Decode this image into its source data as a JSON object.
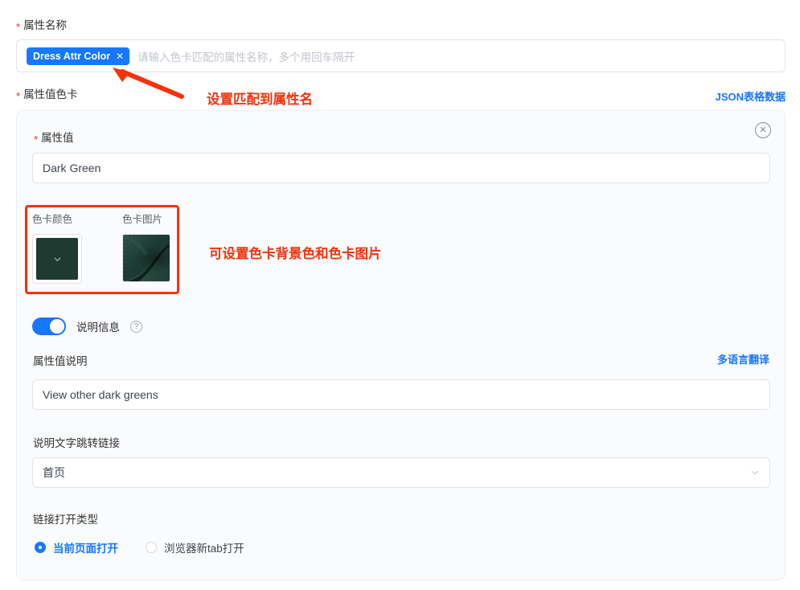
{
  "form": {
    "attr_name": {
      "label": "属性名称",
      "required_mark": "*",
      "tag": "Dress Attr Color",
      "tag_close": "✕",
      "placeholder": "请输入色卡匹配的属性名称，多个用回车隔开"
    },
    "attr_card": {
      "label": "属性值色卡",
      "required_mark": "*",
      "json_link": "JSON表格数据"
    },
    "card": {
      "close_icon": "✕",
      "attr_value": {
        "label": "属性值",
        "required_mark": "*",
        "value": "Dark Green"
      },
      "swatches": {
        "color_title": "色卡颜色",
        "image_title": "色卡图片",
        "color_hex": "#1f3a31",
        "image_base_hex": "#1d3b33",
        "image_shadow_hex": "#06110d",
        "image_light_hex": "#2e5449"
      },
      "description_toggle": {
        "enabled_label": "说明信息",
        "help_icon": "?",
        "state": "on"
      },
      "description": {
        "label": "属性值说明",
        "multilang_link": "多语言翻译",
        "value": "View other dark greens"
      },
      "jump_link": {
        "label": "说明文字跳转链接",
        "selected": "首页"
      },
      "open_type": {
        "label": "链接打开类型",
        "options": [
          {
            "label": "当前页面打开",
            "selected": true
          },
          {
            "label": "浏览器新tab打开",
            "selected": false
          }
        ]
      }
    }
  },
  "annotations": {
    "arrow_note": "设置匹配到属性名",
    "swatch_note": "可设置色卡背景色和色卡图片"
  },
  "colors": {
    "primary": "#1677ff",
    "annotation_red": "#f4330d",
    "required_star": "#f5222d"
  }
}
